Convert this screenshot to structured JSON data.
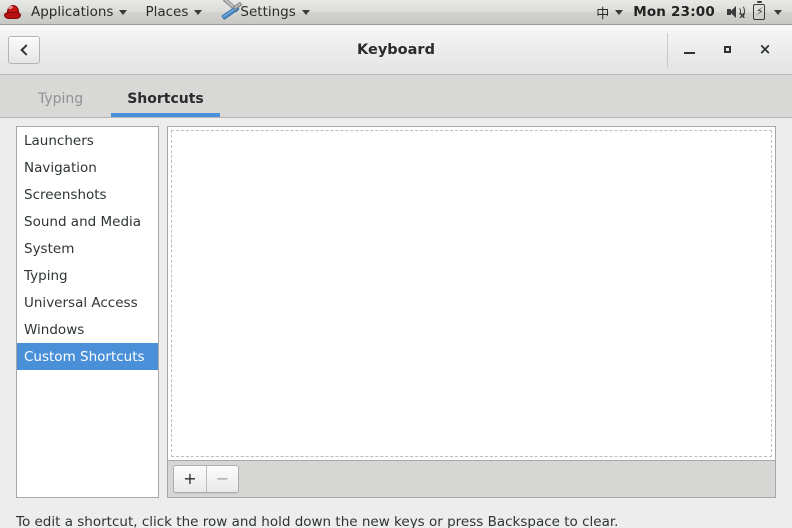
{
  "panel": {
    "logo_icon": "redhat-logo-icon",
    "menus": [
      {
        "label": "Applications",
        "icon": "none"
      },
      {
        "label": "Places",
        "icon": "none"
      },
      {
        "label": "Settings",
        "icon": "tools-icon"
      }
    ],
    "ime_indicator": "中",
    "clock": "Mon 23:00",
    "icons": [
      {
        "name": "volume-muted-icon"
      },
      {
        "name": "battery-charging-icon"
      }
    ]
  },
  "window": {
    "title": "Keyboard",
    "back_button": "back-icon",
    "controls": {
      "minimize": "minimize-icon",
      "maximize": "maximize-icon",
      "close": "×"
    }
  },
  "tabs": [
    {
      "label": "Typing",
      "active": false
    },
    {
      "label": "Shortcuts",
      "active": true
    }
  ],
  "sidebar": {
    "items": [
      {
        "label": "Launchers",
        "selected": false
      },
      {
        "label": "Navigation",
        "selected": false
      },
      {
        "label": "Screenshots",
        "selected": false
      },
      {
        "label": "Sound and Media",
        "selected": false
      },
      {
        "label": "System",
        "selected": false
      },
      {
        "label": "Typing",
        "selected": false
      },
      {
        "label": "Universal Access",
        "selected": false
      },
      {
        "label": "Windows",
        "selected": false
      },
      {
        "label": "Custom Shortcuts",
        "selected": true
      }
    ],
    "selection_color": "#4a90d9"
  },
  "shortcut_list": {
    "rows": [],
    "empty": true
  },
  "toolbar": {
    "add_label": "+",
    "remove_label": "−",
    "remove_disabled": true
  },
  "hint": "To edit a shortcut, click the row and hold down the new keys or press Backspace to clear.",
  "colors": {
    "accent": "#4a90d9",
    "tab_underline": "#4a8fd9",
    "panel_bg": "#d8d8d6",
    "window_bg": "#ededed"
  }
}
